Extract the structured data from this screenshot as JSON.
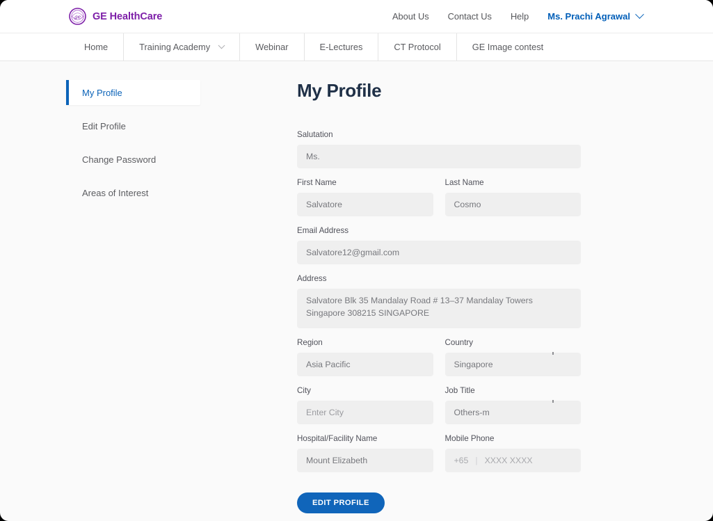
{
  "header": {
    "logo_icon": "ge-healthcare-logo-icon",
    "brand": "GE HealthCare",
    "links": [
      {
        "label": "About Us"
      },
      {
        "label": "Contact Us"
      },
      {
        "label": "Help"
      }
    ],
    "user": {
      "name": "Ms. Prachi Agrawal",
      "caret_icon": "chevron-down-icon"
    }
  },
  "mainnav": {
    "items": [
      {
        "label": "Home",
        "has_caret": false
      },
      {
        "label": "Training Academy",
        "has_caret": true,
        "caret_icon": "chevron-down-icon"
      },
      {
        "label": "Webinar",
        "has_caret": false
      },
      {
        "label": "E-Lectures",
        "has_caret": false
      },
      {
        "label": "CT Protocol",
        "has_caret": false
      },
      {
        "label": "GE Image contest",
        "has_caret": false
      }
    ]
  },
  "sidebar": {
    "items": [
      {
        "label": "My Profile",
        "active": true
      },
      {
        "label": "Edit Profile",
        "active": false
      },
      {
        "label": "Change Password",
        "active": false
      },
      {
        "label": "Areas of Interest",
        "active": false
      }
    ]
  },
  "main": {
    "title": "My Profile",
    "fields": {
      "salutation": {
        "label": "Salutation",
        "value": "Ms."
      },
      "first_name": {
        "label": "First Name",
        "value": "Salvatore"
      },
      "last_name": {
        "label": "Last Name",
        "value": "Cosmo"
      },
      "email": {
        "label": "Email Address",
        "value": "Salvatore12@gmail.com"
      },
      "address": {
        "label": "Address",
        "value": "Salvatore Blk 35 Mandalay Road # 13–37 Mandalay Towers Singapore 308215 SINGAPORE"
      },
      "region": {
        "label": "Region",
        "value": "Asia Pacific"
      },
      "country": {
        "label": "Country",
        "value": "Singapore"
      },
      "city": {
        "label": "City",
        "placeholder": "Enter City",
        "value": ""
      },
      "job_title": {
        "label": "Job Title",
        "value": "Others-m"
      },
      "hospital": {
        "label": "Hospital/Facility Name",
        "value": "Mount Elizabeth"
      },
      "mobile": {
        "label": "Mobile Phone",
        "country_code": "+65",
        "placeholder": "XXXX XXXX",
        "value": ""
      }
    },
    "edit_button": "EDIT PROFILE"
  },
  "colors": {
    "brand_purple": "#7d1fa8",
    "accent_blue": "#005eb8",
    "button_blue": "#1065ba",
    "title_navy": "#1f3047",
    "field_bg": "#efefef",
    "page_bg": "#fafafa"
  }
}
